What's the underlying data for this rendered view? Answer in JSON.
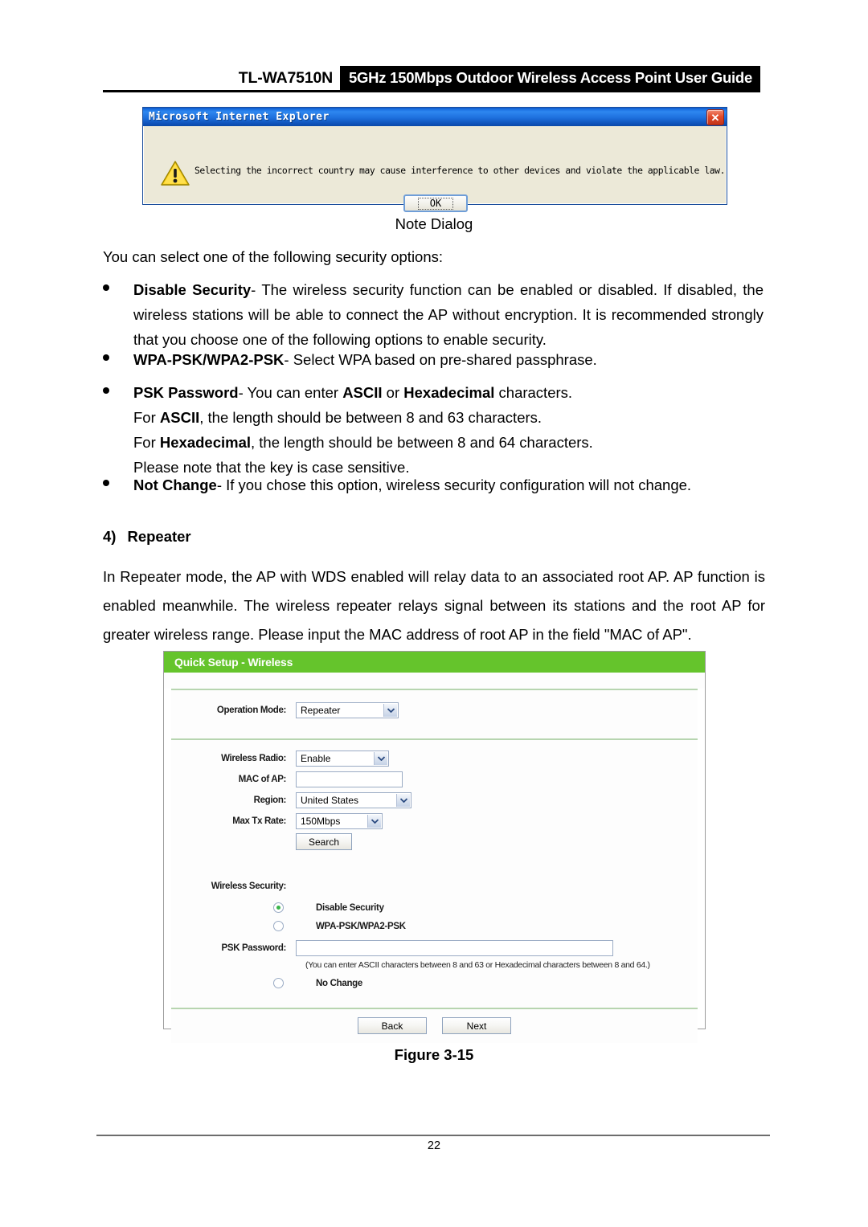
{
  "header": {
    "model": "TL-WA7510N",
    "title": "5GHz 150Mbps Outdoor Wireless Access Point User Guide"
  },
  "dialog": {
    "titlebar": "Microsoft Internet Explorer",
    "close_label": "✕",
    "message": "Selecting the incorrect country may cause interference to other devices and violate the applicable law.",
    "ok_label": "OK",
    "icon": "warning-triangle-icon"
  },
  "body": {
    "note_caption": "Note Dialog",
    "intro": "You can select one of the following security options:",
    "bullets": [
      {
        "term": "Disable Security",
        "rest": "- The wireless security function can be enabled or disabled. If disabled, the wireless stations will be able to connect the AP without encryption. It is recommended strongly that you choose one of the following options to enable security."
      },
      {
        "term": "WPA-PSK/WPA2-PSK",
        "rest": "- Select WPA based on pre-shared passphrase."
      },
      {
        "term": "PSK Password",
        "rest_a": "- You can enter ",
        "bold_a": "ASCII",
        "rest_b": " or ",
        "bold_b": "Hexadecimal",
        "rest_c": " characters.",
        "line2_a": "For ",
        "line2_bold": "ASCII",
        "line2_b": ", the length should be between 8 and 63 characters.",
        "line3_a": "For ",
        "line3_bold": "Hexadecimal",
        "line3_b": ", the length should be between 8 and 64 characters.",
        "line4": "Please note that the key is case sensitive."
      },
      {
        "term": "Not Change",
        "rest": "- If you chose this option, wireless security configuration will not change."
      }
    ],
    "section": {
      "number": "4)",
      "title": "Repeater",
      "paragraph": "In Repeater mode, the AP with WDS enabled will relay data to an associated root AP. AP function is enabled meanwhile. The wireless repeater relays signal between its stations and the root AP for greater wireless range. Please input the MAC address of root AP in the field \"MAC of AP\"."
    },
    "figure_caption": "Figure 3-15"
  },
  "tp_panel": {
    "title": "Quick Setup - Wireless",
    "accent_color": "#65c42c",
    "fields": {
      "operation_mode_label": "Operation Mode:",
      "operation_mode_value": "Repeater",
      "wireless_radio_label": "Wireless Radio:",
      "wireless_radio_value": "Enable",
      "mac_of_ap_label": "MAC of AP:",
      "mac_of_ap_value": "",
      "region_label": "Region:",
      "region_value": "United States",
      "max_tx_rate_label": "Max Tx Rate:",
      "max_tx_rate_value": "150Mbps",
      "search_button": "Search",
      "wireless_security_label": "Wireless Security:",
      "option_disable_security": "Disable Security",
      "option_wpa_psk": "WPA-PSK/WPA2-PSK",
      "psk_password_label": "PSK Password:",
      "psk_password_value": "",
      "psk_hint": "(You can enter ASCII characters between 8 and 63 or Hexadecimal characters between 8 and 64.)",
      "option_no_change": "No Change",
      "back_button": "Back",
      "next_button": "Next"
    }
  },
  "footer": {
    "page_number": "22"
  }
}
